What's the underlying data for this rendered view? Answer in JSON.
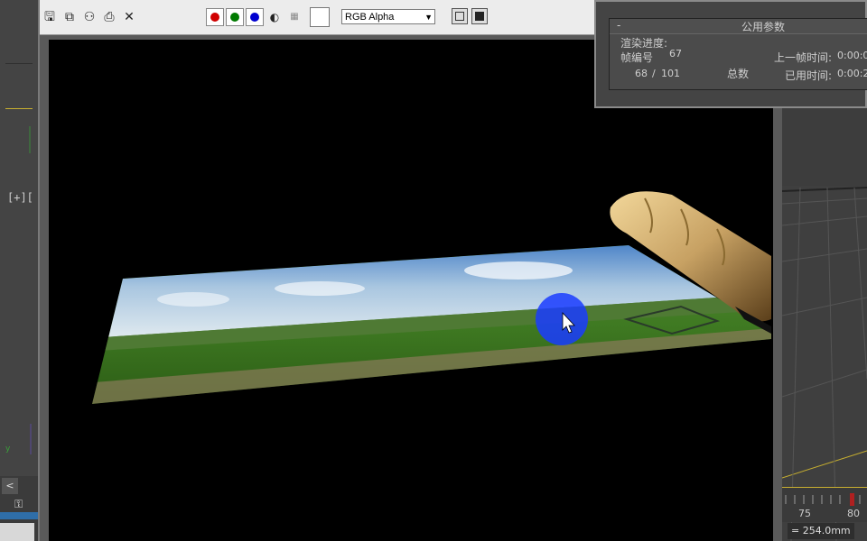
{
  "viewport_label": "[+][",
  "framebuffer": {
    "channel_select": "RGB Alpha",
    "channels": [
      {
        "name": "red",
        "color": "#d00000"
      },
      {
        "name": "green",
        "color": "#007a00"
      },
      {
        "name": "blue",
        "color": "#0000d0"
      }
    ],
    "tools": [
      "save-icon",
      "clone-icon",
      "multi-icon",
      "print-icon",
      "clear-icon"
    ]
  },
  "render_params": {
    "collapse": "-",
    "title": "公用参数",
    "progress_label": "渲染进度:",
    "frame_label": "帧编号",
    "frame_value": "67",
    "frames_current": "68",
    "frames_sep": "/",
    "frames_total": "101",
    "total_label": "总数",
    "last_frame_label": "上一帧时间:",
    "last_frame_value": "0:00:0",
    "elapsed_label": "已用时间:",
    "elapsed_value": "0:00:2"
  },
  "timeline": {
    "tick_a": "75",
    "tick_b": "80"
  },
  "status_field": "= 254.0mm"
}
